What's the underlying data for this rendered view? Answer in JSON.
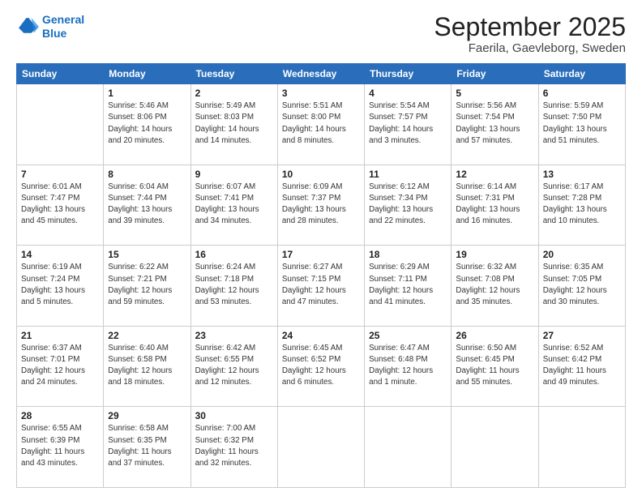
{
  "header": {
    "logo_line1": "General",
    "logo_line2": "Blue",
    "title": "September 2025",
    "subtitle": "Faerila, Gaevleborg, Sweden"
  },
  "columns": [
    "Sunday",
    "Monday",
    "Tuesday",
    "Wednesday",
    "Thursday",
    "Friday",
    "Saturday"
  ],
  "weeks": [
    [
      {
        "day": "",
        "info": ""
      },
      {
        "day": "1",
        "info": "Sunrise: 5:46 AM\nSunset: 8:06 PM\nDaylight: 14 hours\nand 20 minutes."
      },
      {
        "day": "2",
        "info": "Sunrise: 5:49 AM\nSunset: 8:03 PM\nDaylight: 14 hours\nand 14 minutes."
      },
      {
        "day": "3",
        "info": "Sunrise: 5:51 AM\nSunset: 8:00 PM\nDaylight: 14 hours\nand 8 minutes."
      },
      {
        "day": "4",
        "info": "Sunrise: 5:54 AM\nSunset: 7:57 PM\nDaylight: 14 hours\nand 3 minutes."
      },
      {
        "day": "5",
        "info": "Sunrise: 5:56 AM\nSunset: 7:54 PM\nDaylight: 13 hours\nand 57 minutes."
      },
      {
        "day": "6",
        "info": "Sunrise: 5:59 AM\nSunset: 7:50 PM\nDaylight: 13 hours\nand 51 minutes."
      }
    ],
    [
      {
        "day": "7",
        "info": "Sunrise: 6:01 AM\nSunset: 7:47 PM\nDaylight: 13 hours\nand 45 minutes."
      },
      {
        "day": "8",
        "info": "Sunrise: 6:04 AM\nSunset: 7:44 PM\nDaylight: 13 hours\nand 39 minutes."
      },
      {
        "day": "9",
        "info": "Sunrise: 6:07 AM\nSunset: 7:41 PM\nDaylight: 13 hours\nand 34 minutes."
      },
      {
        "day": "10",
        "info": "Sunrise: 6:09 AM\nSunset: 7:37 PM\nDaylight: 13 hours\nand 28 minutes."
      },
      {
        "day": "11",
        "info": "Sunrise: 6:12 AM\nSunset: 7:34 PM\nDaylight: 13 hours\nand 22 minutes."
      },
      {
        "day": "12",
        "info": "Sunrise: 6:14 AM\nSunset: 7:31 PM\nDaylight: 13 hours\nand 16 minutes."
      },
      {
        "day": "13",
        "info": "Sunrise: 6:17 AM\nSunset: 7:28 PM\nDaylight: 13 hours\nand 10 minutes."
      }
    ],
    [
      {
        "day": "14",
        "info": "Sunrise: 6:19 AM\nSunset: 7:24 PM\nDaylight: 13 hours\nand 5 minutes."
      },
      {
        "day": "15",
        "info": "Sunrise: 6:22 AM\nSunset: 7:21 PM\nDaylight: 12 hours\nand 59 minutes."
      },
      {
        "day": "16",
        "info": "Sunrise: 6:24 AM\nSunset: 7:18 PM\nDaylight: 12 hours\nand 53 minutes."
      },
      {
        "day": "17",
        "info": "Sunrise: 6:27 AM\nSunset: 7:15 PM\nDaylight: 12 hours\nand 47 minutes."
      },
      {
        "day": "18",
        "info": "Sunrise: 6:29 AM\nSunset: 7:11 PM\nDaylight: 12 hours\nand 41 minutes."
      },
      {
        "day": "19",
        "info": "Sunrise: 6:32 AM\nSunset: 7:08 PM\nDaylight: 12 hours\nand 35 minutes."
      },
      {
        "day": "20",
        "info": "Sunrise: 6:35 AM\nSunset: 7:05 PM\nDaylight: 12 hours\nand 30 minutes."
      }
    ],
    [
      {
        "day": "21",
        "info": "Sunrise: 6:37 AM\nSunset: 7:01 PM\nDaylight: 12 hours\nand 24 minutes."
      },
      {
        "day": "22",
        "info": "Sunrise: 6:40 AM\nSunset: 6:58 PM\nDaylight: 12 hours\nand 18 minutes."
      },
      {
        "day": "23",
        "info": "Sunrise: 6:42 AM\nSunset: 6:55 PM\nDaylight: 12 hours\nand 12 minutes."
      },
      {
        "day": "24",
        "info": "Sunrise: 6:45 AM\nSunset: 6:52 PM\nDaylight: 12 hours\nand 6 minutes."
      },
      {
        "day": "25",
        "info": "Sunrise: 6:47 AM\nSunset: 6:48 PM\nDaylight: 12 hours\nand 1 minute."
      },
      {
        "day": "26",
        "info": "Sunrise: 6:50 AM\nSunset: 6:45 PM\nDaylight: 11 hours\nand 55 minutes."
      },
      {
        "day": "27",
        "info": "Sunrise: 6:52 AM\nSunset: 6:42 PM\nDaylight: 11 hours\nand 49 minutes."
      }
    ],
    [
      {
        "day": "28",
        "info": "Sunrise: 6:55 AM\nSunset: 6:39 PM\nDaylight: 11 hours\nand 43 minutes."
      },
      {
        "day": "29",
        "info": "Sunrise: 6:58 AM\nSunset: 6:35 PM\nDaylight: 11 hours\nand 37 minutes."
      },
      {
        "day": "30",
        "info": "Sunrise: 7:00 AM\nSunset: 6:32 PM\nDaylight: 11 hours\nand 32 minutes."
      },
      {
        "day": "",
        "info": ""
      },
      {
        "day": "",
        "info": ""
      },
      {
        "day": "",
        "info": ""
      },
      {
        "day": "",
        "info": ""
      }
    ]
  ]
}
